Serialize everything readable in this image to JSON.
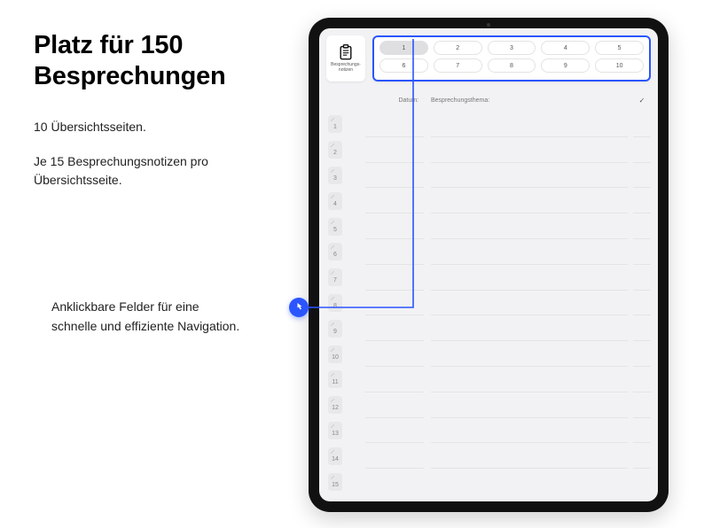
{
  "left": {
    "headline_l1": "Platz für 150",
    "headline_l2": "Besprechungen",
    "sub1": "10 Übersichtsseiten.",
    "sub2": "Je 15 Besprechungsnotizen pro Übersichtsseite.",
    "callout_l1": "Anklickbare Felder für eine",
    "callout_l2": "schnelle und effiziente Navigation."
  },
  "toolbar": {
    "side_label": "Besprechungs-\nnotizen"
  },
  "nav": {
    "pages": [
      "1",
      "2",
      "3",
      "4",
      "5",
      "6",
      "7",
      "8",
      "9",
      "10"
    ],
    "selected": "1"
  },
  "columns": {
    "date": "Datum:",
    "topic": "Besprechungsthema:",
    "check": "✓"
  },
  "rows": [
    "1",
    "2",
    "3",
    "4",
    "5",
    "6",
    "7",
    "8",
    "9",
    "10",
    "11",
    "12",
    "13",
    "14",
    "15"
  ]
}
